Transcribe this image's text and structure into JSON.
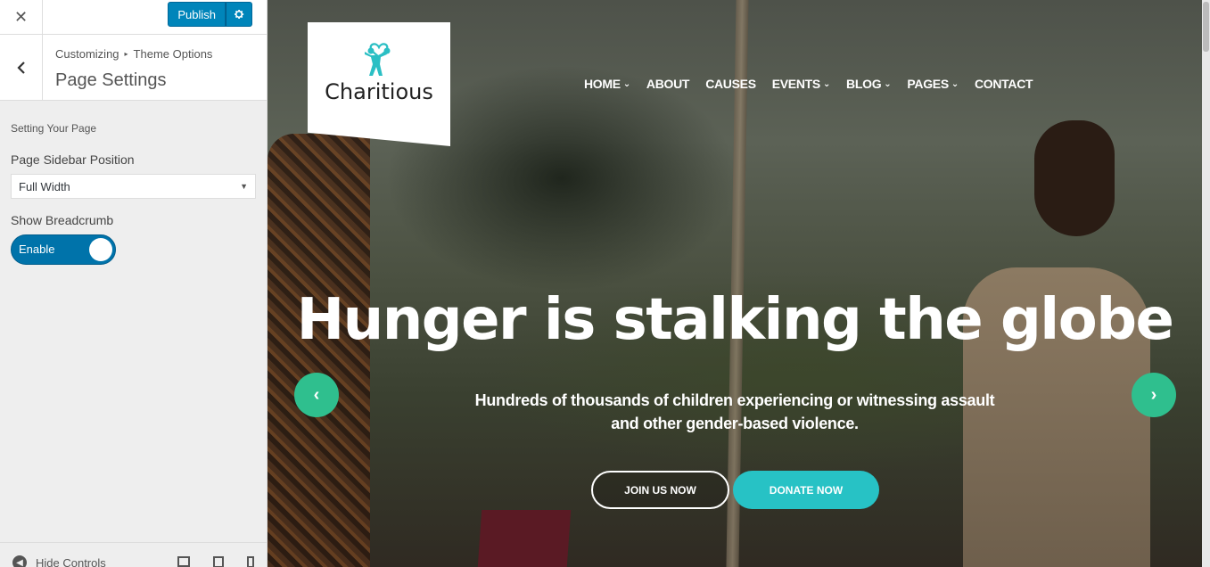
{
  "customizer": {
    "close_icon": "✕",
    "publish_label": "Publish",
    "breadcrumb": {
      "root": "Customizing",
      "separator": "▸",
      "parent": "Theme Options"
    },
    "section_title": "Page Settings",
    "description": "Setting Your Page",
    "sidebar_position": {
      "label": "Page Sidebar Position",
      "value": "Full Width"
    },
    "breadcrumb_toggle": {
      "label": "Show Breadcrumb",
      "value": "Enable",
      "on": true
    },
    "footer": {
      "hide_controls": "Hide Controls",
      "devices": [
        "desktop",
        "tablet",
        "mobile"
      ]
    },
    "accent_color": "#0085ba"
  },
  "preview": {
    "logo_text": "Charitious",
    "logo_color": "#2bbfc4",
    "nav": [
      {
        "label": "HOME",
        "dropdown": true
      },
      {
        "label": "ABOUT",
        "dropdown": false
      },
      {
        "label": "CAUSES",
        "dropdown": false
      },
      {
        "label": "EVENTS",
        "dropdown": true
      },
      {
        "label": "BLOG",
        "dropdown": true
      },
      {
        "label": "PAGES",
        "dropdown": true
      },
      {
        "label": "CONTACT",
        "dropdown": false
      }
    ],
    "hero": {
      "title": "Hunger is stalking the globe",
      "subtitle_line1": "Hundreds of thousands of children experiencing or witnessing assault",
      "subtitle_line2": "and other gender-based violence.",
      "join_button": "JOIN US NOW",
      "donate_button": "DONATE NOW",
      "prev_icon": "‹",
      "next_icon": "›",
      "arrow_color": "#2fbf8e",
      "donate_color": "#27c2c5"
    }
  }
}
